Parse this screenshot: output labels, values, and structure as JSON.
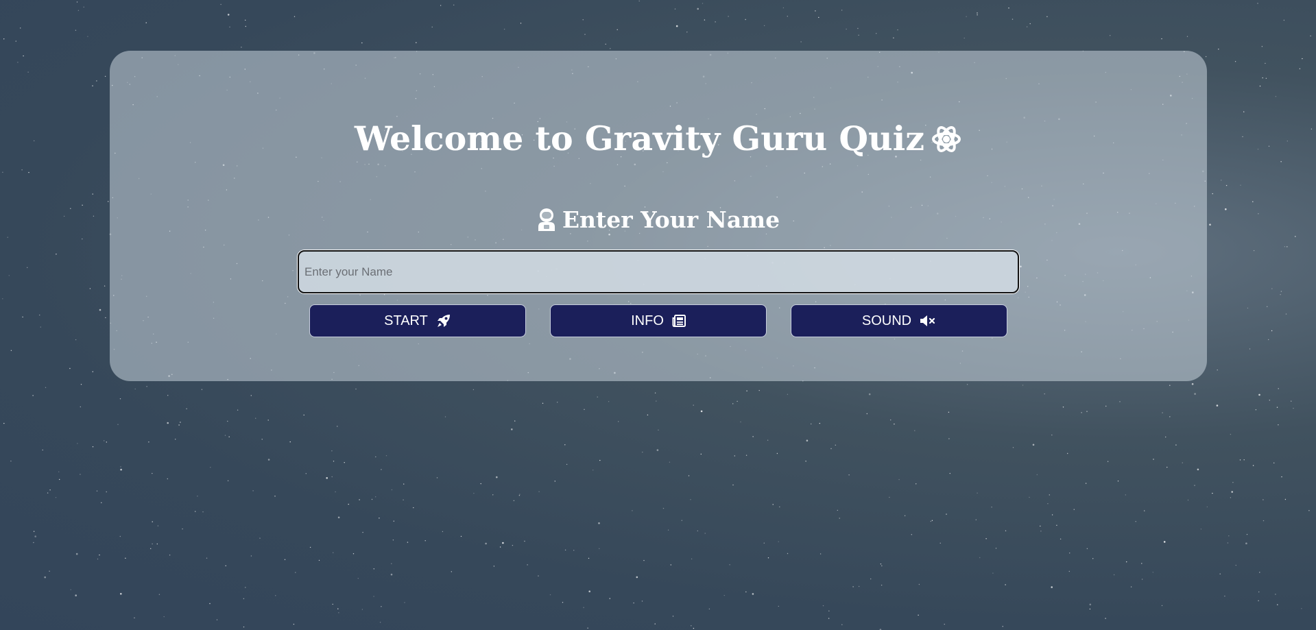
{
  "page": {
    "title": "Welcome to Gravity Guru Quiz",
    "title_icon": "atom-icon",
    "name_heading": "Enter Your Name",
    "name_heading_icon": "astronaut-icon"
  },
  "form": {
    "name_input_placeholder": "Enter your Name",
    "name_input_value": ""
  },
  "buttons": {
    "start_label": "START",
    "start_icon": "rocket-icon",
    "info_label": "INFO",
    "info_icon": "newspaper-icon",
    "sound_label": "SOUND",
    "sound_icon": "volume-mute-icon"
  },
  "colors": {
    "button_background": "#1b1f5a",
    "text": "#ffffff",
    "background": "#36485a"
  }
}
